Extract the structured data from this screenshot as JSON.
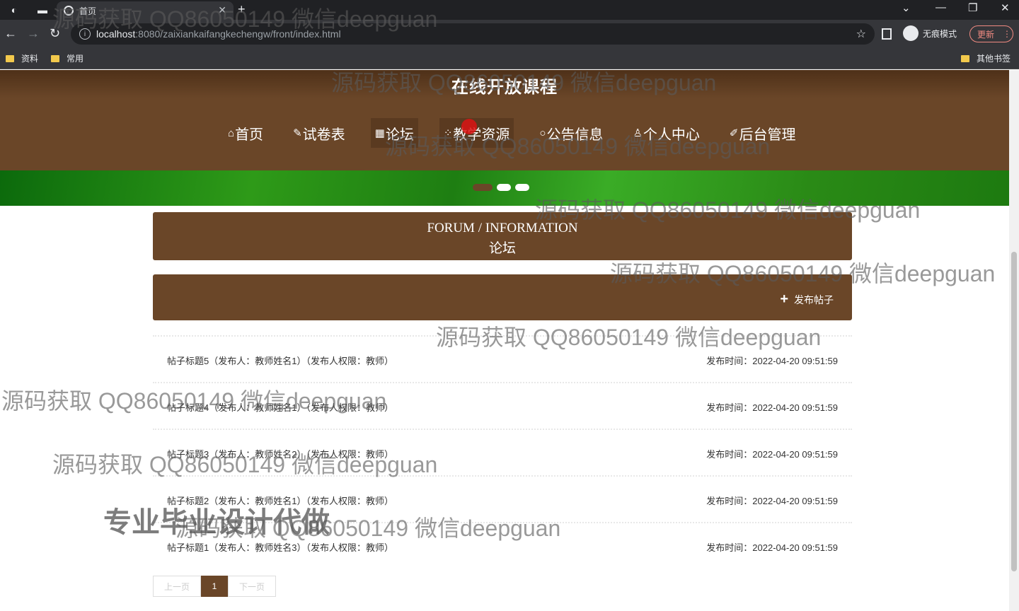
{
  "browser": {
    "tab_title": "首页",
    "url_host": "localhost",
    "url_path": ":8080/zaixiankaifangkechengw/front/index.html",
    "incognito_label": "无痕模式",
    "update_label": "更新",
    "bookmarks": [
      "资料",
      "常用"
    ],
    "other_bookmarks": "其他书签"
  },
  "site": {
    "title": "在线开放课程",
    "menu": [
      {
        "icon": "⌂",
        "label": "首页"
      },
      {
        "icon": "✎",
        "label": "试卷表"
      },
      {
        "icon": "▦",
        "label": "论坛"
      },
      {
        "icon": "⁘",
        "label": "教学资源"
      },
      {
        "icon": "○",
        "label": "公告信息"
      },
      {
        "icon": "♙",
        "label": "个人中心"
      },
      {
        "icon": "✐",
        "label": "后台管理"
      }
    ]
  },
  "section": {
    "title_en": "FORUM / INFORMATION",
    "title_cn": "论坛",
    "post_button": "发布帖子"
  },
  "posts": [
    {
      "title": "帖子标题5（发布人：教师姓名1）（发布人权限：教师）",
      "time": "发布时间：2022-04-20 09:51:59"
    },
    {
      "title": "帖子标题4（发布人：教师姓名1）（发布人权限：教师）",
      "time": "发布时间：2022-04-20 09:51:59"
    },
    {
      "title": "帖子标题3（发布人：教师姓名2）（发布人权限：教师）",
      "time": "发布时间：2022-04-20 09:51:59"
    },
    {
      "title": "帖子标题2（发布人：教师姓名1）（发布人权限：教师）",
      "time": "发布时间：2022-04-20 09:51:59"
    },
    {
      "title": "帖子标题1（发布人：教师姓名3）（发布人权限：教师）",
      "time": "发布时间：2022-04-20 09:51:59"
    }
  ],
  "pager": {
    "prev": "上一页",
    "current": "1",
    "next": "下一页"
  },
  "watermarks": {
    "text": "源码获取 QQ86050149 微信deepguan",
    "big": "专业毕业设计代做"
  },
  "colors": {
    "brown": "#6a4628",
    "banner_green": "#2e9a18"
  }
}
